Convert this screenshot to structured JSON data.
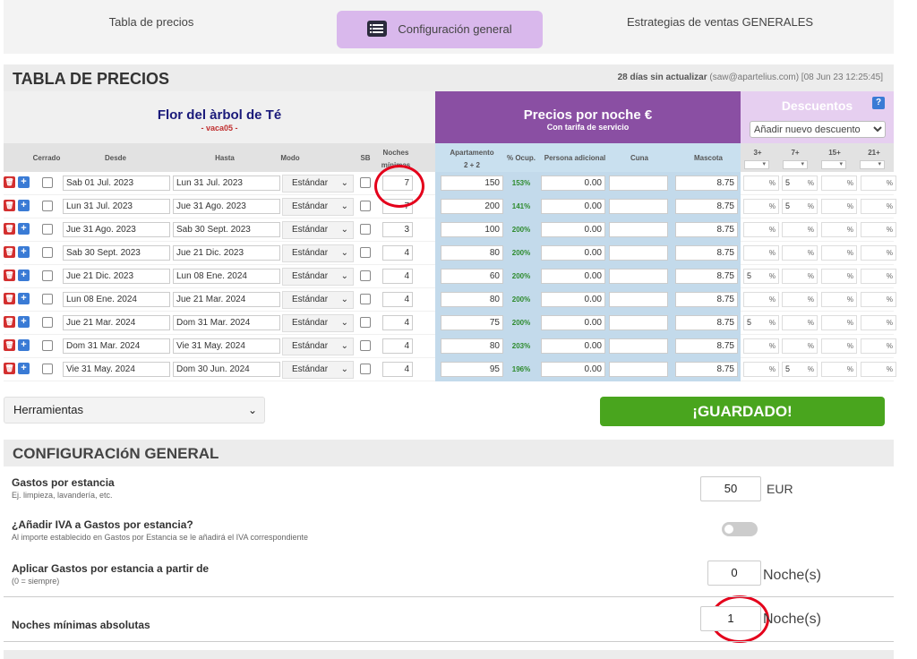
{
  "tabs": {
    "price_table": "Tabla de precios",
    "general_config": "Configuración general",
    "sales_strategies": "Estrategias de ventas GENERALES"
  },
  "price_table": {
    "title": "TABLA DE PRECIOS",
    "update_bold": "28 días sin actualizar",
    "update_rest": " (saw@apartelius.com) [08 Jun 23 12:25:45]",
    "property_name": "Flor del àrbol de Té",
    "property_code": "- vaca05 -",
    "prices_title": "Precios por noche €",
    "prices_sub": "Con tarifa de servicio",
    "discounts_title": "Descuentos",
    "help_label": "?",
    "add_discount": "Añadir nuevo descuento",
    "columns": {
      "closed": "Cerrado",
      "from": "Desde",
      "to": "Hasta",
      "mode": "Modo",
      "sb": "SB",
      "min_nights_1": "Noches",
      "min_nights_2": "mínimas",
      "apt_1": "Apartamento",
      "apt_2": "2 + 2",
      "occupancy": "% Ocup.",
      "extra_person": "Persona adicional",
      "crib": "Cuna",
      "pet": "Mascota",
      "d3": "3+",
      "d7": "7+",
      "d15": "15+",
      "d21": "21+"
    },
    "rows": [
      {
        "from": "Sab 01 Jul. 2023",
        "to": "Lun 31 Jul. 2023",
        "mode": "Estándar",
        "min": "7",
        "apt": "150",
        "occ": "153%",
        "extra": "0.00",
        "crib": "",
        "pet": "8.75",
        "d3": "",
        "d7": "5",
        "d15": "",
        "d21": ""
      },
      {
        "from": "Lun 31 Jul. 2023",
        "to": "Jue 31 Ago. 2023",
        "mode": "Estándar",
        "min": "7",
        "apt": "200",
        "occ": "141%",
        "extra": "0.00",
        "crib": "",
        "pet": "8.75",
        "d3": "",
        "d7": "5",
        "d15": "",
        "d21": ""
      },
      {
        "from": "Jue 31 Ago. 2023",
        "to": "Sab 30 Sept. 2023",
        "mode": "Estándar",
        "min": "3",
        "apt": "100",
        "occ": "200%",
        "extra": "0.00",
        "crib": "",
        "pet": "8.75",
        "d3": "",
        "d7": "",
        "d15": "",
        "d21": ""
      },
      {
        "from": "Sab 30 Sept. 2023",
        "to": "Jue 21 Dic. 2023",
        "mode": "Estándar",
        "min": "4",
        "apt": "80",
        "occ": "200%",
        "extra": "0.00",
        "crib": "",
        "pet": "8.75",
        "d3": "",
        "d7": "",
        "d15": "",
        "d21": ""
      },
      {
        "from": "Jue 21 Dic. 2023",
        "to": "Lun 08 Ene. 2024",
        "mode": "Estándar",
        "min": "4",
        "apt": "60",
        "occ": "200%",
        "extra": "0.00",
        "crib": "",
        "pet": "8.75",
        "d3": "5",
        "d7": "",
        "d15": "",
        "d21": ""
      },
      {
        "from": "Lun 08 Ene. 2024",
        "to": "Jue 21 Mar. 2024",
        "mode": "Estándar",
        "min": "4",
        "apt": "80",
        "occ": "200%",
        "extra": "0.00",
        "crib": "",
        "pet": "8.75",
        "d3": "",
        "d7": "",
        "d15": "",
        "d21": ""
      },
      {
        "from": "Jue 21 Mar. 2024",
        "to": "Dom 31 Mar. 2024",
        "mode": "Estándar",
        "min": "4",
        "apt": "75",
        "occ": "200%",
        "extra": "0.00",
        "crib": "",
        "pet": "8.75",
        "d3": "5",
        "d7": "",
        "d15": "",
        "d21": ""
      },
      {
        "from": "Dom 31 Mar. 2024",
        "to": "Vie 31 May. 2024",
        "mode": "Estándar",
        "min": "4",
        "apt": "80",
        "occ": "203%",
        "extra": "0.00",
        "crib": "",
        "pet": "8.75",
        "d3": "",
        "d7": "",
        "d15": "",
        "d21": ""
      },
      {
        "from": "Vie 31 May. 2024",
        "to": "Dom 30 Jun. 2024",
        "mode": "Estándar",
        "min": "4",
        "apt": "95",
        "occ": "196%",
        "extra": "0.00",
        "crib": "",
        "pet": "8.75",
        "d3": "",
        "d7": "5",
        "d15": "",
        "d21": ""
      }
    ],
    "pct_sign": "%"
  },
  "tools_label": "Herramientas",
  "save_label": "¡GUARDADO!",
  "general": {
    "title": "CONFIGURACIóN GENERAL",
    "stay_costs_label": "Gastos por estancia",
    "stay_costs_sub": "Ej. limpieza, lavandería, etc.",
    "stay_costs_value": "50",
    "stay_costs_unit": "EUR",
    "vat_label": "¿Añadir IVA a Gastos por estancia?",
    "vat_sub": "Al importe establecido en Gastos por Estancia se le añadirá el IVA correspondiente",
    "apply_from_label": "Aplicar Gastos por estancia a partir de",
    "apply_from_sub": "(0 = siempre)",
    "apply_from_value": "0",
    "apply_from_unit": "Noche(s)",
    "abs_min_label": "Noches mínimas absolutas",
    "abs_min_value": "1",
    "abs_min_unit": "Noche(s)"
  },
  "colors": {
    "accent_purple": "#8a4fa3",
    "tab_active": "#d9b8ec",
    "save_green": "#49a51e",
    "highlight_ring": "#e4001b"
  },
  "icons": [
    "list-icon",
    "trash-icon",
    "plus-icon",
    "chevron-down-icon",
    "help-icon"
  ]
}
